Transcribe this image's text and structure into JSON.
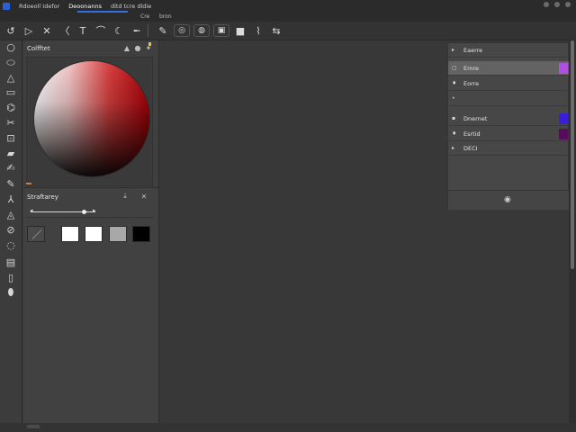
{
  "menubar": {
    "items": [
      {
        "label": "Rdoeoll  Idefor"
      },
      {
        "label": "Deoonanns"
      },
      {
        "label": "ditd   tcre   dldie"
      }
    ]
  },
  "subtabs": [
    {
      "label": "Cre"
    },
    {
      "label": "bron"
    }
  ],
  "color_panel": {
    "title": "Colfftet"
  },
  "brush_panel": {
    "title": "Straftarey"
  },
  "layers": [
    {
      "label": "Eaerre",
      "icon": "▸"
    },
    {
      "label": "Emre",
      "icon": "▢",
      "selected": true,
      "chip": "#b14fe0"
    },
    {
      "label": "Eorre",
      "icon": "♦"
    },
    {
      "label": "",
      "icon": "•"
    },
    {
      "label": "Dnernet",
      "icon": "▪",
      "chip": "#3a1fd8"
    },
    {
      "label": "Esrtid",
      "icon": "♦",
      "chip": "#5a0a5c"
    },
    {
      "label": "DECI",
      "icon": "▸"
    }
  ],
  "swatches": [
    "#ffffff",
    "#ffffff",
    "#a8a8a8",
    "#000000"
  ],
  "colors": {
    "accent": "#2f6fe0",
    "selected_layer_chip": "#b14fe0",
    "chip_blue": "#3a1fd8",
    "chip_purple": "#5a0a5c"
  }
}
